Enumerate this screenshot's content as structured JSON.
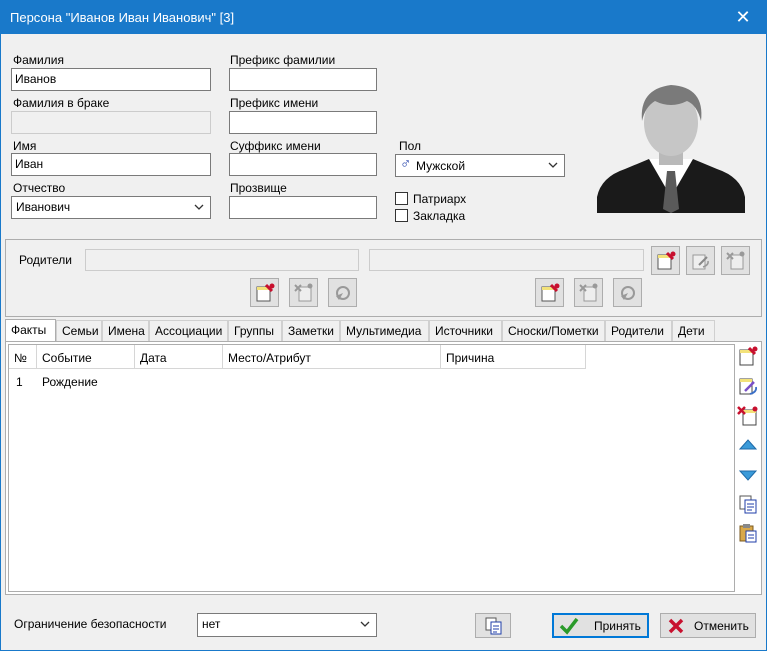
{
  "window": {
    "title": "Персона \"Иванов Иван Иванович\" [3]",
    "close_glyph": "✕"
  },
  "person": {
    "surname_label": "Фамилия",
    "surname_value": "Иванов",
    "married_surname_label": "Фамилия в браке",
    "married_surname_value": "",
    "name_label": "Имя",
    "name_value": "Иван",
    "patronymic_label": "Отчество",
    "patronymic_value": "Иванович",
    "surname_prefix_label": "Префикс фамилии",
    "surname_prefix_value": "",
    "name_prefix_label": "Префикс имени",
    "name_prefix_value": "",
    "name_suffix_label": "Суффикс имени",
    "name_suffix_value": "",
    "nickname_label": "Прозвище",
    "nickname_value": "",
    "sex_label": "Пол",
    "sex_value": "Мужской",
    "sex_glyph": "♂",
    "patriarch_label": "Патриарх",
    "patriarch_checked": false,
    "bookmark_label": "Закладка",
    "bookmark_checked": false
  },
  "parents": {
    "label": "Родители",
    "father_value": "",
    "mother_value": ""
  },
  "tabs": [
    {
      "label": "Факты",
      "active": true
    },
    {
      "label": "Семьи"
    },
    {
      "label": "Имена"
    },
    {
      "label": "Ассоциации"
    },
    {
      "label": "Группы"
    },
    {
      "label": "Заметки"
    },
    {
      "label": "Мультимедиа"
    },
    {
      "label": "Источники"
    },
    {
      "label": "Сноски/Пометки"
    },
    {
      "label": "Родители"
    },
    {
      "label": "Дети"
    }
  ],
  "facts_table": {
    "columns": [
      "№",
      "Событие",
      "Дата",
      "Место/Атрибут",
      "Причина"
    ],
    "rows": [
      [
        "1",
        "Рождение",
        "",
        "",
        ""
      ]
    ]
  },
  "footer": {
    "security_label": "Ограничение безопасности",
    "security_value": "нет",
    "accept_label": "Принять",
    "cancel_label": "Отменить"
  },
  "colors": {
    "titlebar": "#1979ca",
    "accept_icon": "#2a9a2a",
    "cancel_icon": "#c8102e",
    "sex_icon": "#1f3ea8"
  }
}
